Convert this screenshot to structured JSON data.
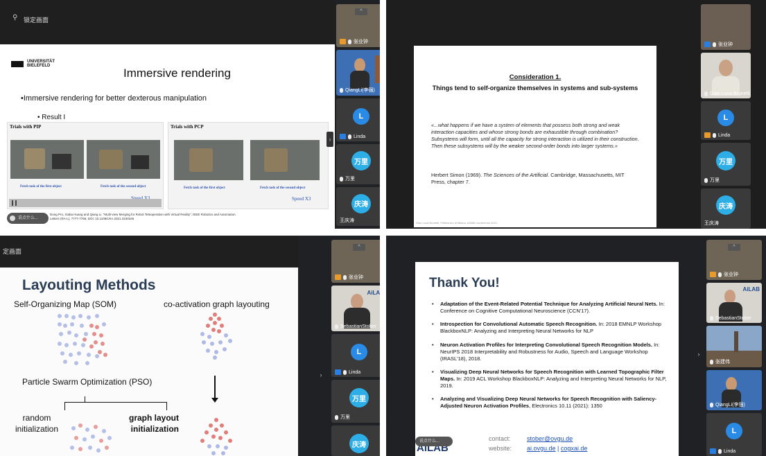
{
  "q1": {
    "toolbar_title": "锁定画面",
    "logo_line1": "UNIVERSITÄT",
    "logo_line2": "BIELEFELD",
    "slide_title": "Immersive rendering",
    "bullet": "•Immersive rendering for better dexterous manipulation",
    "subbullet": "• Result I",
    "panel_left_title": "Trials with PIP",
    "panel_right_title": "Trials with PCP",
    "cap1": "Fetch task of the first object",
    "cap2": "Fetch task of the second object",
    "cap3": "Fetch task of the first object",
    "cap4": "Fetch task of the second object",
    "speed1": "Speed X3",
    "speed2": "Speed X3",
    "footer": "Dong Pro, Xiaba Huang and Qiang Li. \"Multi-view Merging for Robot Teleoperation with Virtual Reality\", IEEE Robotics and Automation",
    "footer2": "Letters (RA-L), 7777-7766, DOI: 10.1109/LRA.2021.3100346",
    "chat_hint": "说点什么...",
    "participants": [
      {
        "name": "张业钟"
      },
      {
        "name": "QiangLi(李强)"
      },
      {
        "name": "Linda",
        "initial": "L"
      },
      {
        "name": "万里",
        "initial": "万里"
      },
      {
        "name": "王庆涛",
        "initial": "庆涛"
      }
    ]
  },
  "q2": {
    "heading": "Consideration 1.",
    "subheading": "Things tend to self-organize themselves in systems and sub-systems",
    "quote": "«...what happens if we have a system of elements that possess both strong and weak interaction capacities and whose strong bonds are exhaustible through combination? Subsystems will form, until all the capacity for strong interaction is utilized in their construction. Then these subsystems will by the weaker second-order bonds into larger systems.»",
    "ref_a": "Herbert Simon (1969). ",
    "ref_b": "The Sciences of the Artificial",
    "ref_c": ". Cambridge, Massachusetts, MIT Press, chapter 7.",
    "footer": "Gian Luca Brunetti, Politecnico di Milano, ASMB Conference 2021",
    "participants": [
      {
        "name": "张业钟"
      },
      {
        "name": "Gian Luca Brunetti"
      },
      {
        "name": "Linda",
        "initial": "L"
      },
      {
        "name": "万里",
        "initial": "万里"
      },
      {
        "name": "王庆涛",
        "initial": "庆涛"
      }
    ]
  },
  "q3": {
    "toolbar_title": "定画面",
    "title": "Layouting Methods",
    "som": "Self-Organizing Map (SOM)",
    "coact": "co-activation graph layouting",
    "pso": "Particle Swarm Optimization (PSO)",
    "random1": "random",
    "random2": "initialization",
    "graph1": "graph layout",
    "graph2": "initialization",
    "participants": [
      {
        "name": "张业钟"
      },
      {
        "name": "SebastianStober"
      },
      {
        "name": "Linda",
        "initial": "L"
      },
      {
        "name": "万里",
        "initial": "万里"
      },
      {
        "name": "庆涛",
        "initial": "庆涛"
      }
    ],
    "ailab": "AiLAB"
  },
  "q4": {
    "title": "Thank You!",
    "refs": [
      {
        "bold": "Adaptation of the Event-Related Potential Technique for Analyzing Artificial Neural Nets.",
        "rest": " In: Conference on Cognitive Computational Neuroscience (CCN'17)."
      },
      {
        "bold": "Introspection for Convolutional Automatic Speech Recognition.",
        "rest": " In: 2018 EMNLP Workshop BlackboxNLP: Analyzing and Interpreting Neural Networks for NLP"
      },
      {
        "bold": "Neuron Activation Profiles for Interpreting Convolutional Speech Recognition Models.",
        "rest": " In: NeurIPS 2018 Interpretability and Robustness for Audio, Speech and Language Workshop (IRASL'18), 2018."
      },
      {
        "bold": "Visualizing Deep Neural Networks for Speech Recognition with Learned Topographic Filter Maps.",
        "rest": " In: 2019 ACL Workshop BlackboxNLP: Analyzing and Interpreting Neural Networks for NLP, 2019."
      },
      {
        "bold": "Analyzing and Visualizing Deep Neural Networks for Speech Recognition with Saliency-Adjusted Neuron Activation Profiles",
        "rest": ", Electronics 10.11 (2021): 1350"
      }
    ],
    "contact_label": "contact:",
    "contact_value": "stober@ovgu.de",
    "website_label": "website:",
    "website_value1": "ai.ovgu.de",
    "website_sep": " | ",
    "website_value2": "cogxai.de",
    "chat_hint": "说点什么...",
    "logo": "AiLAB",
    "participants": [
      {
        "name": "张业钟"
      },
      {
        "name": "SebastianStober"
      },
      {
        "name": "张建伟"
      },
      {
        "name": "QiangLi(李强)"
      },
      {
        "name": "Linda",
        "initial": "L"
      }
    ]
  },
  "colors": {
    "accent": "#2a8be6",
    "link": "#1a4fb5",
    "title_blue": "#1f3b5c"
  }
}
